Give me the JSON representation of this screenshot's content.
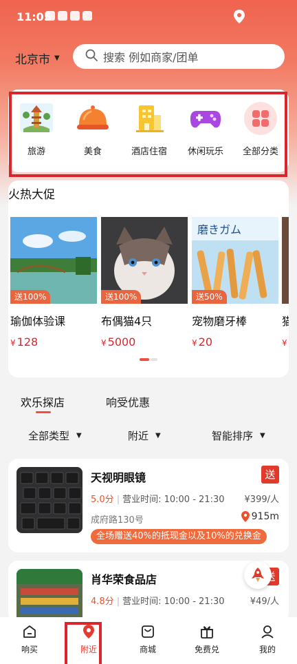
{
  "status_bar": {
    "time": "11:05"
  },
  "header": {
    "city": "北京市",
    "search_placeholder": "搜索 例如商家/团单"
  },
  "categories": [
    {
      "label": "旅游",
      "icon": "travel-icon"
    },
    {
      "label": "美食",
      "icon": "food-cloche-icon"
    },
    {
      "label": "酒店住宿",
      "icon": "hotel-icon"
    },
    {
      "label": "休闲玩乐",
      "icon": "gamepad-icon"
    },
    {
      "label": "全部分类",
      "icon": "all-categories-icon"
    }
  ],
  "promo": {
    "title": "火热大促",
    "items": [
      {
        "name": "瑜伽体验课",
        "price": "128",
        "badge": "送100%"
      },
      {
        "name": "布偶猫4只",
        "price": "5000",
        "badge": "送100%"
      },
      {
        "name": "宠物磨牙棒",
        "price": "20",
        "badge": "送50%"
      },
      {
        "name": "猫",
        "price": "",
        "badge": ""
      }
    ],
    "currency": "¥"
  },
  "tabs": [
    {
      "label": "欢乐探店",
      "active": true
    },
    {
      "label": "响受优惠",
      "active": false
    }
  ],
  "filters": [
    {
      "label": "全部类型"
    },
    {
      "label": "附近"
    },
    {
      "label": "智能排序"
    }
  ],
  "shops": [
    {
      "name": "天视明眼镜",
      "score": "5.0分",
      "hours_label": "营业时间:",
      "hours": "10:00 - 21:30",
      "price": "¥399/人",
      "address": "成府路130号",
      "distance": "915m",
      "promo": "全场赠送40%的抵现金以及10%的兑换金",
      "badge": "送"
    },
    {
      "name": "肖华荣食品店",
      "score": "4.8分",
      "hours_label": "营业时间:",
      "hours": "10:00 - 21:30",
      "price": "¥49/人",
      "badge": "送"
    }
  ],
  "bottom_nav": [
    {
      "label": "响买",
      "icon": "home-icon",
      "active": false
    },
    {
      "label": "附近",
      "icon": "location-pin-icon",
      "active": true
    },
    {
      "label": "商城",
      "icon": "shopping-bag-icon",
      "active": false
    },
    {
      "label": "免费兑",
      "icon": "gift-icon",
      "active": false
    },
    {
      "label": "我的",
      "icon": "user-icon",
      "active": false
    }
  ],
  "colors": {
    "accent": "#e53b2f",
    "promo_orange": "#f16a3c",
    "header_gradient_top": "#f0634f"
  }
}
